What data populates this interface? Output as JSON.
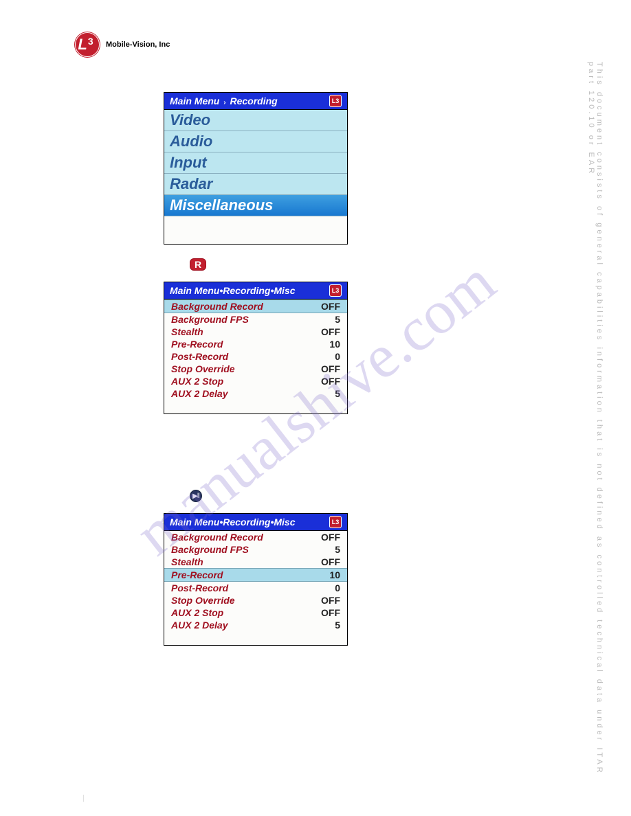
{
  "company": "Mobile-Vision, Inc",
  "logo_l": "L",
  "logo_3": "3",
  "watermark": "manualshive.com",
  "side_note": "This document consists of general capabilities information that is not defined as controlled technical data under  ITAR part 120.10 or EAR",
  "page_num": "|",
  "r_label": "R",
  "play_label": "▶‖",
  "header_logo": "L3",
  "menu1": {
    "breadcrumb_a": "Main Menu",
    "breadcrumb_sep": "›",
    "breadcrumb_b": "Recording",
    "items": [
      {
        "label": "Video",
        "selected": false
      },
      {
        "label": "Audio",
        "selected": false
      },
      {
        "label": "Input",
        "selected": false
      },
      {
        "label": "Radar",
        "selected": false
      },
      {
        "label": "Miscellaneous",
        "selected": true
      }
    ]
  },
  "menu2": {
    "breadcrumb": "Main Menu•Recording•Misc",
    "rows": [
      {
        "label": "Background Record",
        "value": "OFF",
        "highlight": true
      },
      {
        "label": "Background FPS",
        "value": "5",
        "highlight": false
      },
      {
        "label": "Stealth",
        "value": "OFF",
        "highlight": false
      },
      {
        "label": "Pre-Record",
        "value": "10",
        "highlight": false
      },
      {
        "label": "Post-Record",
        "value": "0",
        "highlight": false
      },
      {
        "label": "Stop Override",
        "value": "OFF",
        "highlight": false
      },
      {
        "label": "AUX 2 Stop",
        "value": "OFF",
        "highlight": false
      },
      {
        "label": "AUX 2 Delay",
        "value": "5",
        "highlight": false
      }
    ]
  },
  "menu3": {
    "breadcrumb": "Main Menu•Recording•Misc",
    "rows": [
      {
        "label": "Background Record",
        "value": "OFF",
        "highlight": false
      },
      {
        "label": "Background FPS",
        "value": "5",
        "highlight": false
      },
      {
        "label": "Stealth",
        "value": "OFF",
        "highlight": false
      },
      {
        "label": "Pre-Record",
        "value": "10",
        "highlight": true
      },
      {
        "label": "Post-Record",
        "value": "0",
        "highlight": false
      },
      {
        "label": "Stop Override",
        "value": "OFF",
        "highlight": false
      },
      {
        "label": "AUX 2 Stop",
        "value": "OFF",
        "highlight": false
      },
      {
        "label": "AUX 2 Delay",
        "value": "5",
        "highlight": false
      }
    ]
  }
}
